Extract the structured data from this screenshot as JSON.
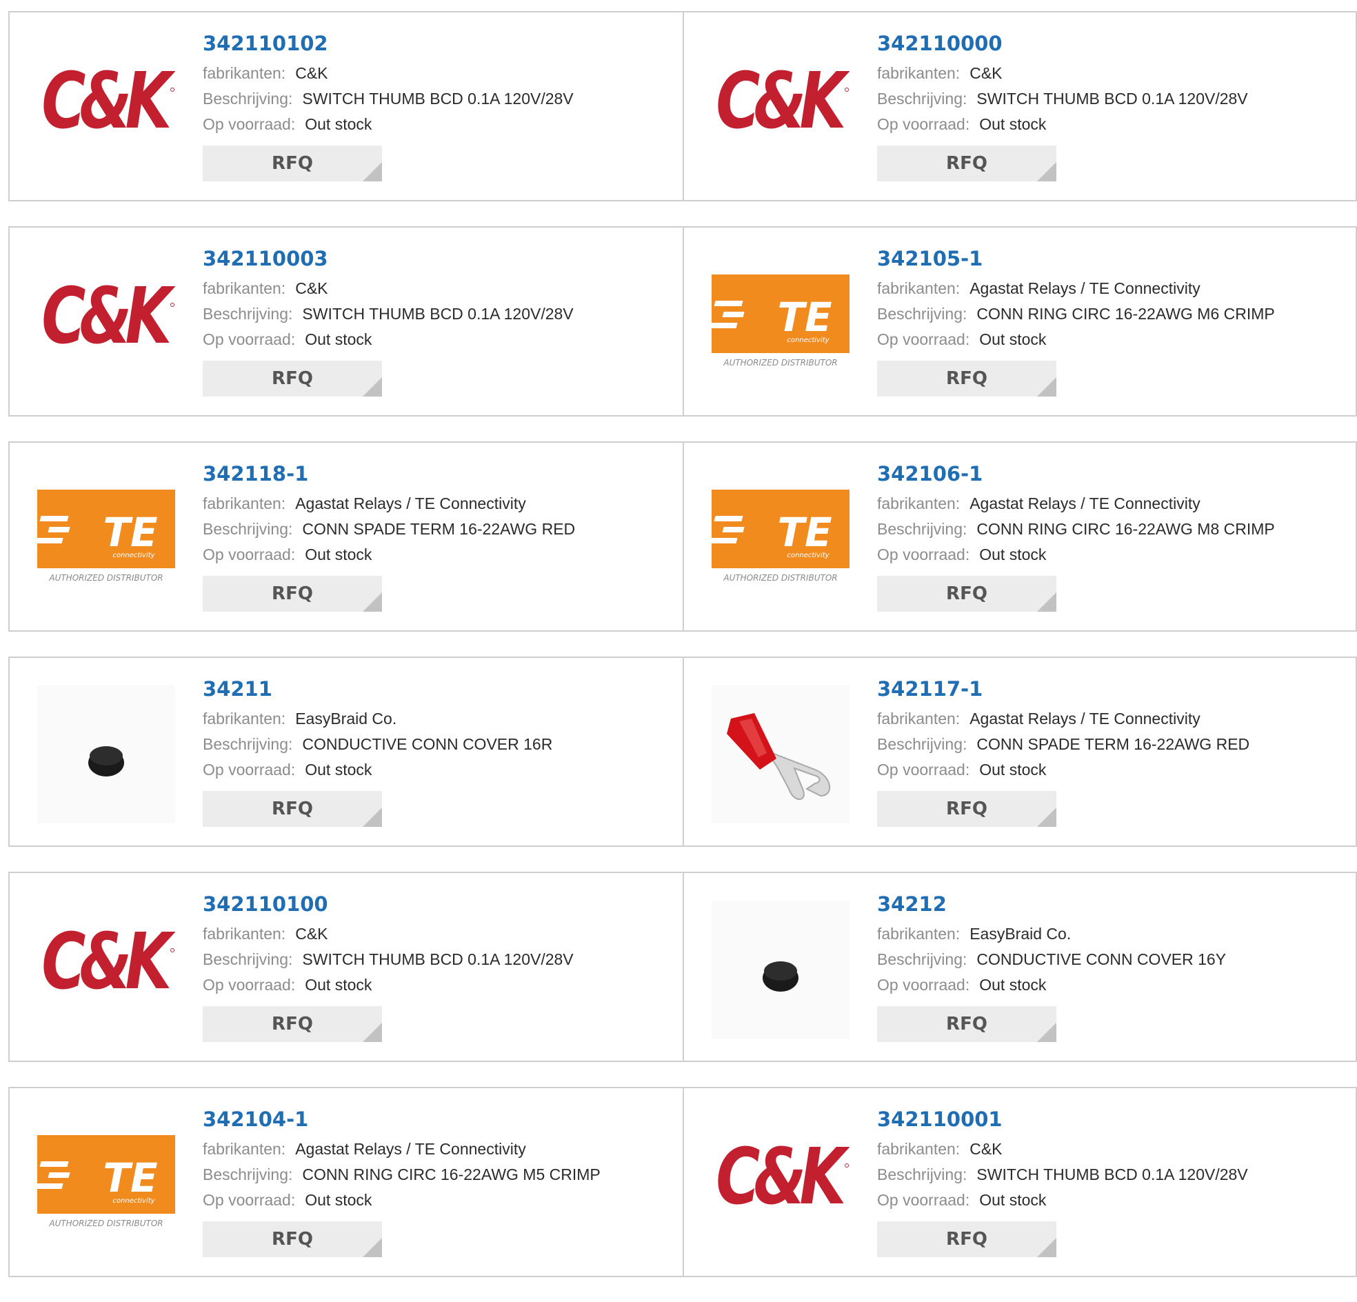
{
  "labels": {
    "manufacturer": "fabrikanten:",
    "description": "Beschrijving:",
    "stock": "Op voorraad:",
    "rfq": "RFQ"
  },
  "logos": {
    "ck": {
      "text": "C&K",
      "color": "#c3202f"
    },
    "te": {
      "text": "TE",
      "sub": "connectivity",
      "tagline": "AUTHORIZED DISTRIBUTOR",
      "color": "#f28b1e"
    }
  },
  "products": [
    {
      "part": "342110102",
      "manufacturer": "C&K",
      "description": "SWITCH THUMB BCD 0.1A 120V/28V",
      "stock": "Out stock",
      "image": "ck-logo"
    },
    {
      "part": "342110000",
      "manufacturer": "C&K",
      "description": "SWITCH THUMB BCD 0.1A 120V/28V",
      "stock": "Out stock",
      "image": "ck-logo"
    },
    {
      "part": "342110003",
      "manufacturer": "C&K",
      "description": "SWITCH THUMB BCD 0.1A 120V/28V",
      "stock": "Out stock",
      "image": "ck-logo"
    },
    {
      "part": "342105-1",
      "manufacturer": "Agastat Relays / TE Connectivity",
      "description": "CONN RING CIRC 16-22AWG M6 CRIMP",
      "stock": "Out stock",
      "image": "te-logo"
    },
    {
      "part": "342118-1",
      "manufacturer": "Agastat Relays / TE Connectivity",
      "description": "CONN SPADE TERM 16-22AWG RED",
      "stock": "Out stock",
      "image": "te-logo"
    },
    {
      "part": "342106-1",
      "manufacturer": "Agastat Relays / TE Connectivity",
      "description": "CONN RING CIRC 16-22AWG M8 CRIMP",
      "stock": "Out stock",
      "image": "te-logo"
    },
    {
      "part": "34211",
      "manufacturer": "EasyBraid Co.",
      "description": "CONDUCTIVE CONN COVER 16R",
      "stock": "Out stock",
      "image": "black-cover-photo"
    },
    {
      "part": "342117-1",
      "manufacturer": "Agastat Relays / TE Connectivity",
      "description": "CONN SPADE TERM 16-22AWG RED",
      "stock": "Out stock",
      "image": "spade-terminal-photo"
    },
    {
      "part": "342110100",
      "manufacturer": "C&K",
      "description": "SWITCH THUMB BCD 0.1A 120V/28V",
      "stock": "Out stock",
      "image": "ck-logo"
    },
    {
      "part": "34212",
      "manufacturer": "EasyBraid Co.",
      "description": "CONDUCTIVE CONN COVER 16Y",
      "stock": "Out stock",
      "image": "black-cover-photo"
    },
    {
      "part": "342104-1",
      "manufacturer": "Agastat Relays / TE Connectivity",
      "description": "CONN RING CIRC 16-22AWG M5 CRIMP",
      "stock": "Out stock",
      "image": "te-logo"
    },
    {
      "part": "342110001",
      "manufacturer": "C&K",
      "description": "SWITCH THUMB BCD 0.1A 120V/28V",
      "stock": "Out stock",
      "image": "ck-logo"
    }
  ]
}
